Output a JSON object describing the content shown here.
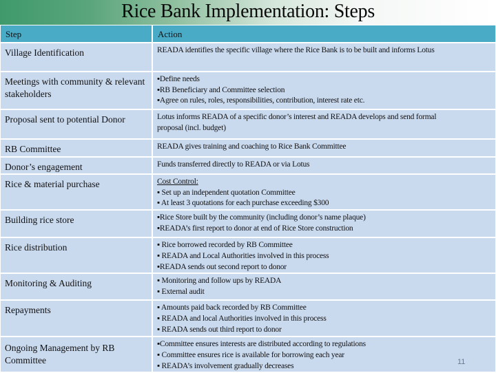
{
  "slide": {
    "title": "Rice Bank Implementation: Steps",
    "page_number": "11"
  },
  "table": {
    "headers": {
      "step": "Step",
      "action": "Action"
    },
    "rows": [
      {
        "step": "Village Identification",
        "action": [
          "READA identifies the specific village where the Rice Bank is to be built and informs Lotus"
        ]
      },
      {
        "step": "Meetings with  community & relevant stakeholders",
        "action": [
          "▪Define needs",
          "▪RB Beneficiary and Committee selection",
          "▪Agree on rules, roles, responsibilities, contribution, interest rate etc."
        ]
      },
      {
        "step": "Proposal sent to potential Donor",
        "action": [
          "Lotus informs READA of a specific donor’s interest and READA develops and send formal",
          "proposal (incl. budget)"
        ]
      },
      {
        "step": "RB Committee",
        "action": [
          "READA gives training and coaching to Rice Bank Committee"
        ]
      },
      {
        "step": "Donor’s engagement",
        "action": [
          "Funds transferred directly to READA or via Lotus"
        ]
      },
      {
        "step": "Rice & material purchase",
        "action_heading": "Cost Control:",
        "action": [
          "▪ Set up an independent quotation Committee",
          "▪ At least 3 quotations for each purchase exceeding $300"
        ]
      },
      {
        "step": "Building rice store",
        "action": [
          "▪Rice Store built by the community (including donor’s name plaque)",
          "▪READA’s first report to donor at end of Rice Store construction"
        ]
      },
      {
        "step": "Rice distribution",
        "action": [
          "▪ Rice borrowed recorded by RB Committee",
          "▪ READA and Local Authorities involved in this process",
          "▪READA sends out second report to donor"
        ]
      },
      {
        "step": "Monitoring  & Auditing",
        "action": [
          "▪ Monitoring and follow ups by READA",
          "▪ External audit"
        ]
      },
      {
        "step": "Repayments",
        "action": [
          "▪ Amounts paid back recorded by RB Committee",
          "▪ READA and local Authorities involved in this process",
          "▪ READA sends out third report to donor"
        ]
      },
      {
        "step": "Ongoing Management by RB Committee",
        "action": [
          "▪Committee ensures interests are distributed according to regulations",
          "▪ Committee ensures rice is available for borrowing each year",
          "▪ READA’s involvement gradually decreases"
        ]
      }
    ]
  },
  "colors": {
    "header_bg": "#4aabc6",
    "row_bg": "#c9d9ee",
    "title_gradient_start": "#3f9a6b"
  }
}
